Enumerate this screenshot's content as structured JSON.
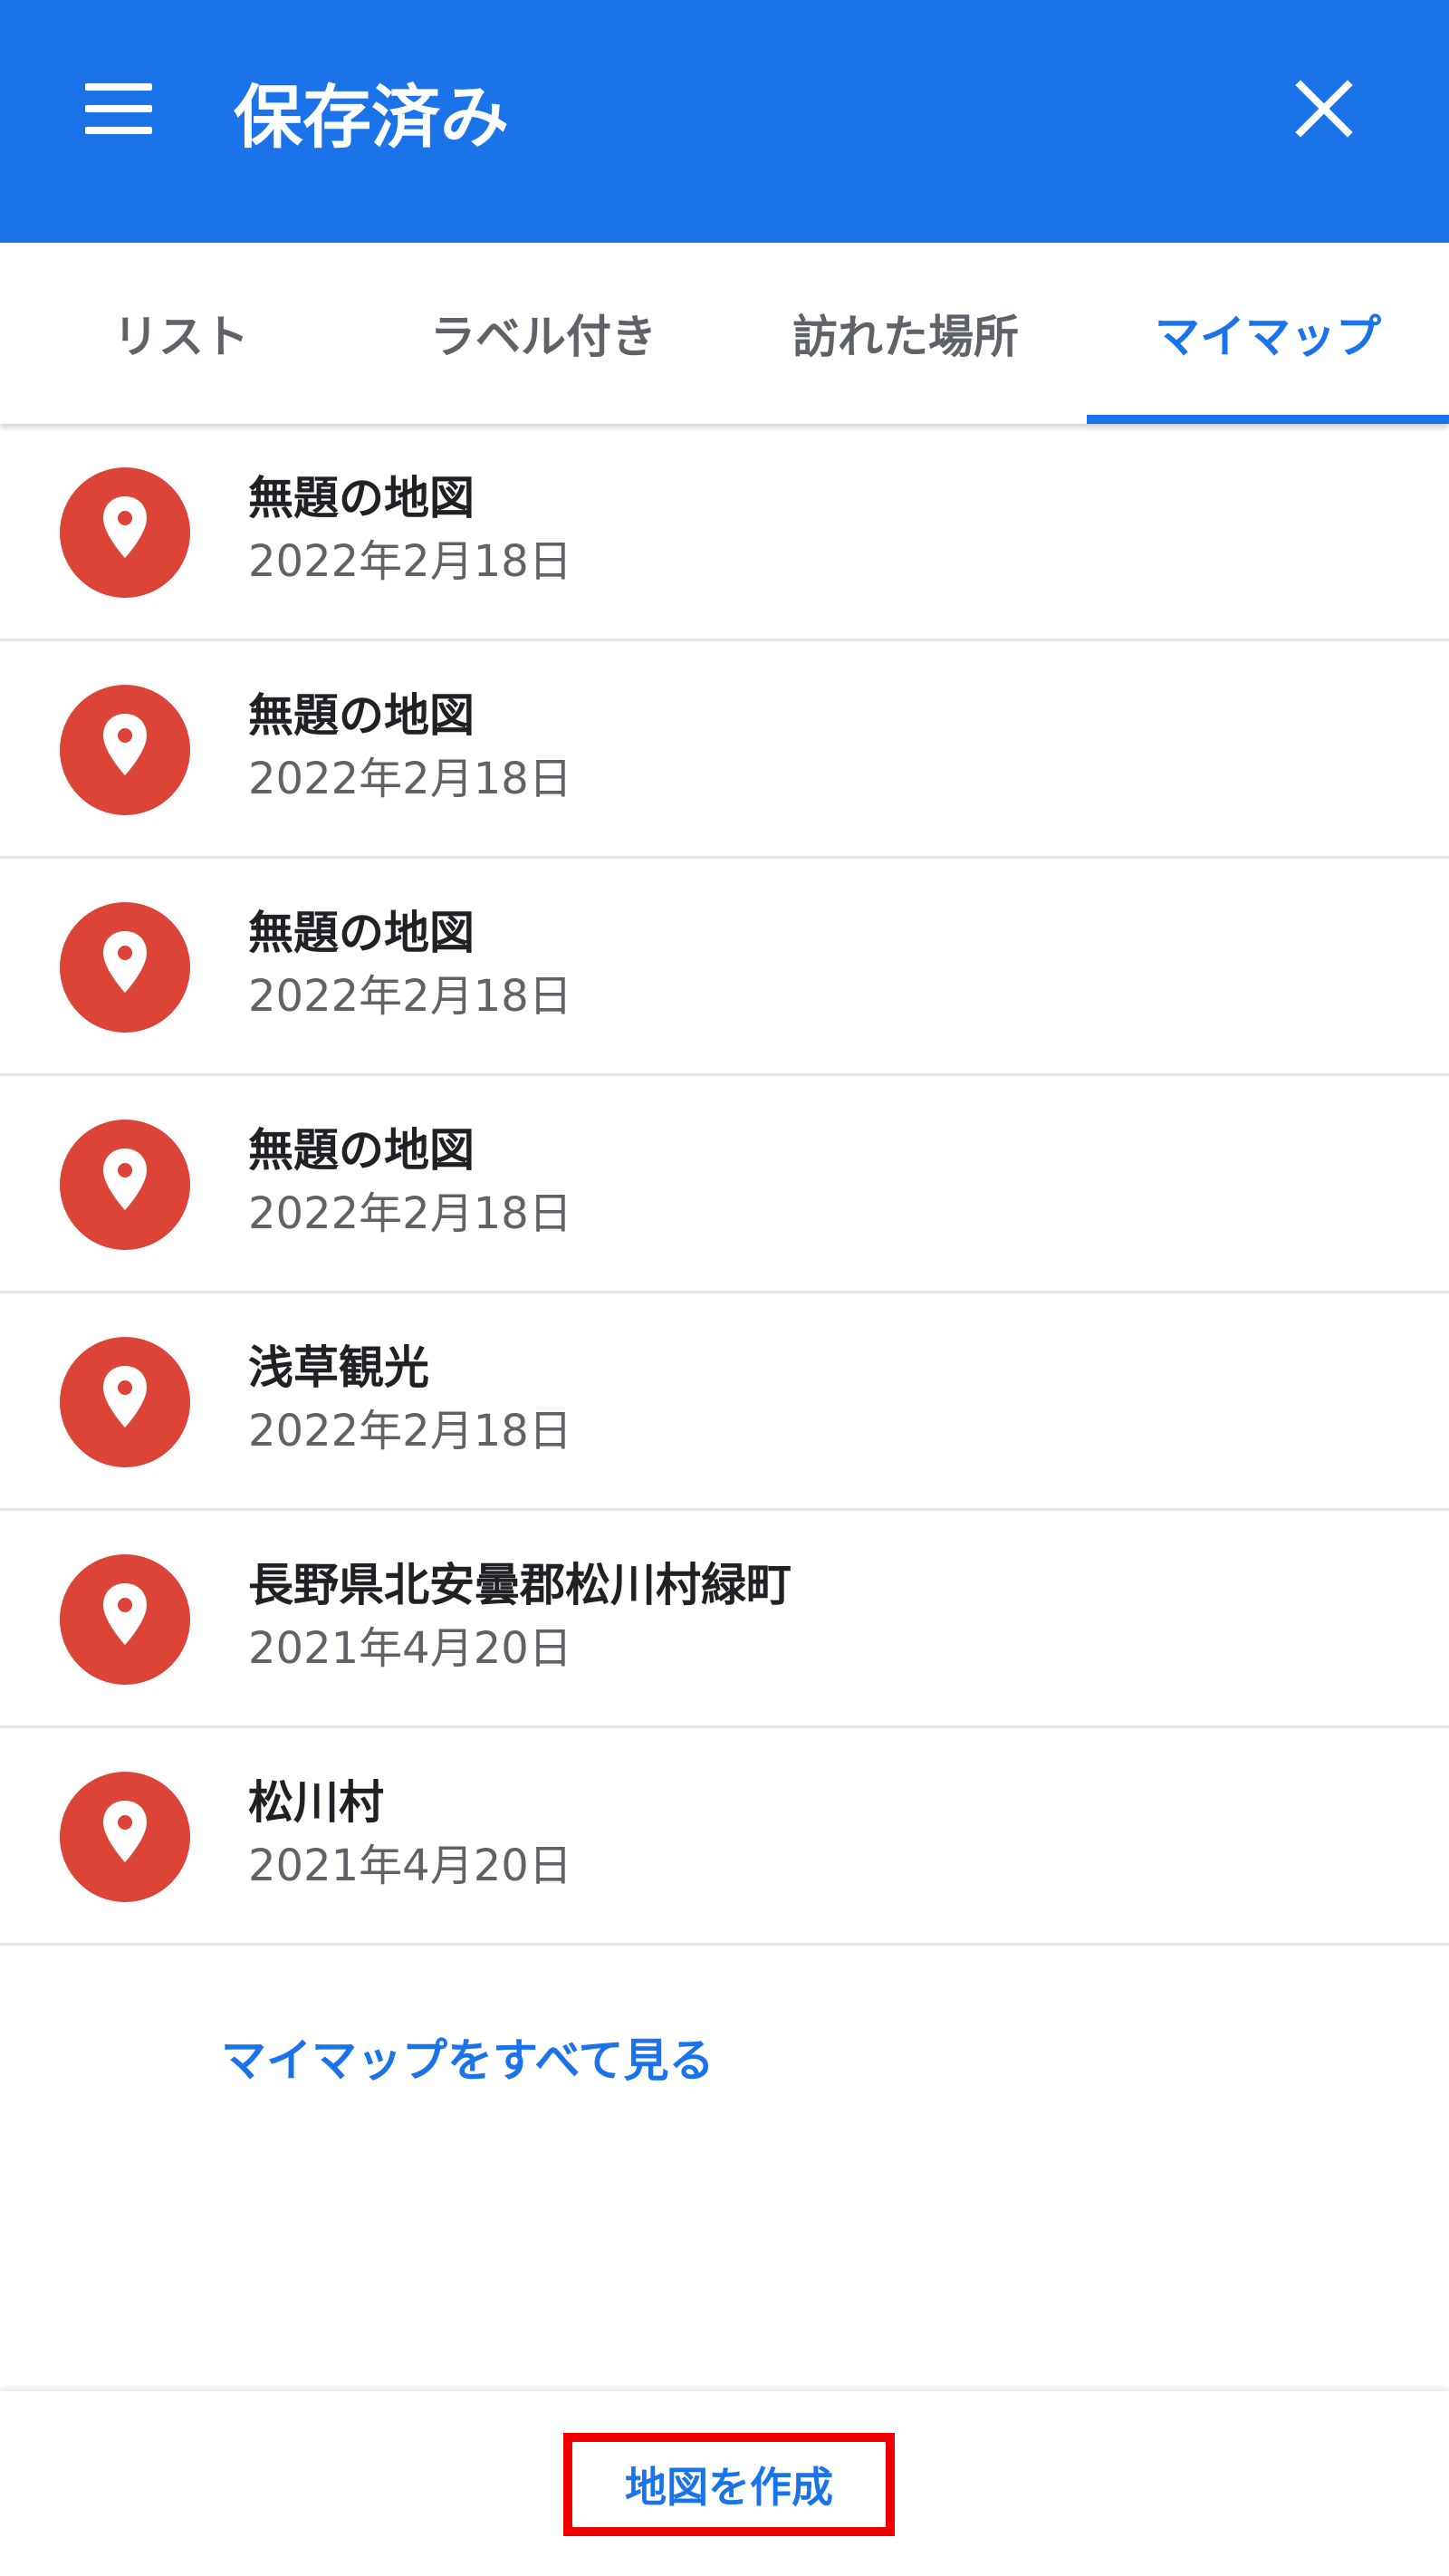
{
  "appbar": {
    "title": "保存済み",
    "menu_icon": "menu-icon",
    "close_icon": "close-icon",
    "color": "#1a73e8"
  },
  "tabs": [
    {
      "label": "リスト",
      "active": false
    },
    {
      "label": "ラベル付き",
      "active": false
    },
    {
      "label": "訪れた場所",
      "active": false
    },
    {
      "label": "マイマップ",
      "active": true
    }
  ],
  "maps": [
    {
      "title": "無題の地図",
      "date": "2022年2月18日",
      "icon": "map-pin-icon"
    },
    {
      "title": "無題の地図",
      "date": "2022年2月18日",
      "icon": "map-pin-icon"
    },
    {
      "title": "無題の地図",
      "date": "2022年2月18日",
      "icon": "map-pin-icon"
    },
    {
      "title": "無題の地図",
      "date": "2022年2月18日",
      "icon": "map-pin-icon"
    },
    {
      "title": "浅草観光",
      "date": "2022年2月18日",
      "icon": "map-pin-icon"
    },
    {
      "title": "長野県北安曇郡松川村緑町",
      "date": "2021年4月20日",
      "icon": "map-pin-icon"
    },
    {
      "title": "松川村",
      "date": "2021年4月20日",
      "icon": "map-pin-icon"
    }
  ],
  "see_all_label": "マイマップをすべて見る",
  "create_map_label": "地図を作成",
  "colors": {
    "accent": "#1a73e8",
    "pin": "#db4437",
    "highlight_box": "#ee0000"
  }
}
